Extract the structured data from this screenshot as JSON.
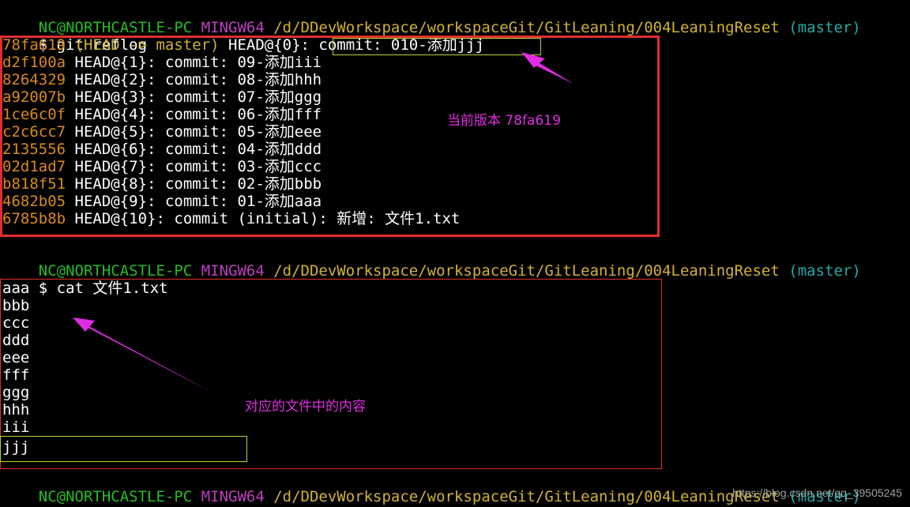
{
  "prompt": {
    "user_host": "NC@NORTHCASTLE-PC",
    "shell": "MINGW64",
    "path": "/d/DDevWorkspace/workspaceGit/GitLeaning/004LeaningReset",
    "branch": "(master)",
    "symbol": "$"
  },
  "commands": {
    "reflog": "git reflog",
    "cat": "cat 文件1.txt"
  },
  "reflog": [
    {
      "hash": "78fa619",
      "decor": "(HEAD -> master)",
      "ref": "HEAD@{0}:",
      "msg": "commit: 010-添加jjj"
    },
    {
      "hash": "d2f100a",
      "decor": "",
      "ref": "HEAD@{1}:",
      "msg": "commit: 09-添加iii"
    },
    {
      "hash": "8264329",
      "decor": "",
      "ref": "HEAD@{2}:",
      "msg": "commit: 08-添加hhh"
    },
    {
      "hash": "a92007b",
      "decor": "",
      "ref": "HEAD@{3}:",
      "msg": "commit: 07-添加ggg"
    },
    {
      "hash": "1ce6c0f",
      "decor": "",
      "ref": "HEAD@{4}:",
      "msg": "commit: 06-添加fff"
    },
    {
      "hash": "c2c6cc7",
      "decor": "",
      "ref": "HEAD@{5}:",
      "msg": "commit: 05-添加eee"
    },
    {
      "hash": "2135556",
      "decor": "",
      "ref": "HEAD@{6}:",
      "msg": "commit: 04-添加ddd"
    },
    {
      "hash": "02d1ad7",
      "decor": "",
      "ref": "HEAD@{7}:",
      "msg": "commit: 03-添加ccc"
    },
    {
      "hash": "b818f51",
      "decor": "",
      "ref": "HEAD@{8}:",
      "msg": "commit: 02-添加bbb"
    },
    {
      "hash": "4682b05",
      "decor": "",
      "ref": "HEAD@{9}:",
      "msg": "commit: 01-添加aaa"
    },
    {
      "hash": "6785b8b",
      "decor": "",
      "ref": "HEAD@{10}:",
      "msg": "commit (initial): 新增: 文件1.txt"
    }
  ],
  "file_lines": [
    "aaa",
    "bbb",
    "ccc",
    "ddd",
    "eee",
    "fff",
    "ggg",
    "hhh",
    "iii",
    "jjj"
  ],
  "annotations": {
    "current_version": "当前版本 78fa619",
    "file_content": "对应的文件中的内容"
  },
  "watermark": "https://blog.csdn.net/qq_39505245",
  "colors": {
    "annotation": "#e22ce2",
    "red_box": "#e0302c",
    "green_box": "#b5d334",
    "hash": "#d98a1c",
    "prompt_user": "#25bc24",
    "prompt_shell": "#bc3fbc",
    "prompt_path": "#d2b233",
    "prompt_branch": "#23a9a9"
  }
}
